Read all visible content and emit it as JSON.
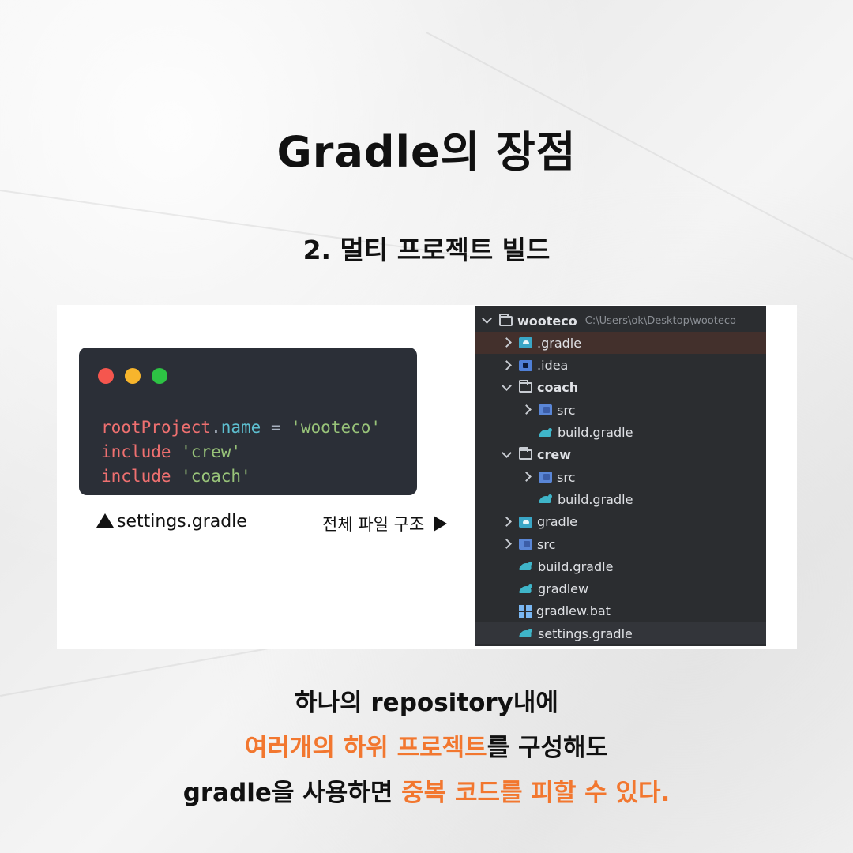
{
  "title": "Gradle의 장점",
  "subtitle": "2. 멀티 프로젝트 빌드",
  "code_window": {
    "lines": [
      [
        {
          "t": "rootProject",
          "c": "tok-var"
        },
        {
          "t": ".",
          "c": "tok-op"
        },
        {
          "t": "name",
          "c": "tok-prop"
        },
        {
          "t": " = ",
          "c": "tok-op"
        },
        {
          "t": "'wooteco'",
          "c": "tok-str"
        }
      ],
      [
        {
          "t": "include ",
          "c": "tok-kw"
        },
        {
          "t": "'crew'",
          "c": "tok-str"
        }
      ],
      [
        {
          "t": "include ",
          "c": "tok-kw"
        },
        {
          "t": "'coach'",
          "c": "tok-str"
        }
      ]
    ]
  },
  "labels": {
    "settings": "settings.gradle",
    "structure": "전체 파일 구조"
  },
  "file_tree": {
    "rows": [
      {
        "indent": 0,
        "chevron": "down",
        "icon": "folder",
        "label": "wooteco",
        "path": "C:\\Users\\ok\\Desktop\\wooteco",
        "bold": true
      },
      {
        "indent": 1,
        "chevron": "right",
        "icon": "gfolder",
        "label": ".gradle",
        "state": "sel"
      },
      {
        "indent": 1,
        "chevron": "right",
        "icon": "ideafolder",
        "label": ".idea"
      },
      {
        "indent": 1,
        "chevron": "down",
        "icon": "folder",
        "label": "coach",
        "bold": true
      },
      {
        "indent": 2,
        "chevron": "right",
        "icon": "srcfolder",
        "label": "src"
      },
      {
        "indent": 2,
        "chevron": "none",
        "icon": "elephant",
        "label": "build.gradle"
      },
      {
        "indent": 1,
        "chevron": "down",
        "icon": "folder",
        "label": "crew",
        "bold": true
      },
      {
        "indent": 2,
        "chevron": "right",
        "icon": "srcfolder",
        "label": "src"
      },
      {
        "indent": 2,
        "chevron": "none",
        "icon": "elephant",
        "label": "build.gradle"
      },
      {
        "indent": 1,
        "chevron": "right",
        "icon": "gfolder",
        "label": "gradle"
      },
      {
        "indent": 1,
        "chevron": "right",
        "icon": "srcfolder",
        "label": "src"
      },
      {
        "indent": 1,
        "chevron": "none",
        "icon": "elephant",
        "label": "build.gradle"
      },
      {
        "indent": 1,
        "chevron": "none",
        "icon": "elephant",
        "label": "gradlew"
      },
      {
        "indent": 1,
        "chevron": "none",
        "icon": "windows",
        "label": "gradlew.bat"
      },
      {
        "indent": 1,
        "chevron": "none",
        "icon": "elephant",
        "label": "settings.gradle",
        "state": "hl"
      }
    ]
  },
  "bottom_text": {
    "line1": "하나의 repository내에",
    "line2_highlight": "여러개의 하위 프로젝트",
    "line2_rest": "를 구성해도",
    "line3_start": "gradle을 사용하면 ",
    "line3_highlight": "중복 코드를 피할 수 있다."
  },
  "colors": {
    "accent_orange": "#f2772f",
    "code_bg": "#2b2f37",
    "tree_bg": "#2b2d30"
  }
}
